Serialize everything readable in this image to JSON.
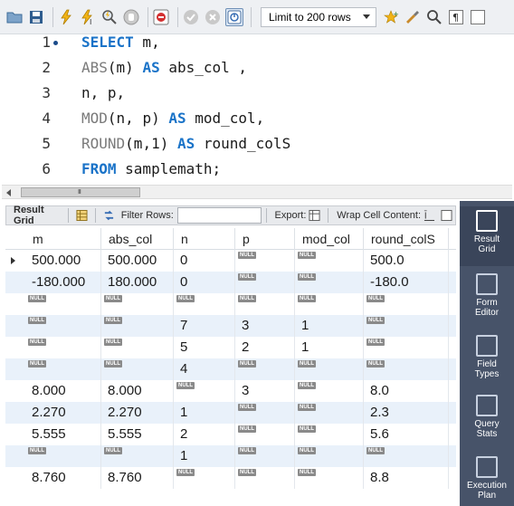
{
  "toolbar": {
    "limit_label": "Limit to 200 rows",
    "icons": [
      "folder-icon",
      "save-icon",
      "execute-icon",
      "execute-current-icon",
      "explain-icon",
      "stop-icon",
      "toggle-error-icon",
      "commit-icon",
      "rollback-icon",
      "autocommit-icon",
      "beautify-icon",
      "search-icon",
      "invisible-chars-icon",
      "wrap-icon"
    ]
  },
  "editor": {
    "line_numbers": [
      "1",
      "2",
      "3",
      "4",
      "5",
      "6"
    ],
    "lines": [
      [
        {
          "t": "SELECT",
          "c": "kw"
        },
        {
          "t": " m,",
          "c": ""
        }
      ],
      [
        {
          "t": "ABS",
          "c": "fn"
        },
        {
          "t": "(m) ",
          "c": ""
        },
        {
          "t": "AS",
          "c": "kw"
        },
        {
          "t": " abs_col ,",
          "c": ""
        }
      ],
      [
        {
          "t": "n, p,",
          "c": ""
        }
      ],
      [
        {
          "t": "MOD",
          "c": "fn"
        },
        {
          "t": "(n, p) ",
          "c": ""
        },
        {
          "t": "AS",
          "c": "kw"
        },
        {
          "t": " mod_col,",
          "c": ""
        }
      ],
      [
        {
          "t": "ROUND",
          "c": "fn"
        },
        {
          "t": "(m,1) ",
          "c": ""
        },
        {
          "t": "AS",
          "c": "kw"
        },
        {
          "t": " round_colS",
          "c": ""
        }
      ],
      [
        {
          "t": "FROM",
          "c": "kw"
        },
        {
          "t": " samplemath;",
          "c": ""
        }
      ]
    ]
  },
  "hscroll": {
    "grip": "III"
  },
  "result_toolbar": {
    "result_grid_label": "Result Grid",
    "filter_rows_label": "Filter Rows:",
    "filter_rows_value": "",
    "export_label": "Export:",
    "wrap_label": "Wrap Cell Content:"
  },
  "grid": {
    "null_text": "NULL",
    "columns": [
      "m",
      "abs_col",
      "n",
      "p",
      "mod_col",
      "round_colS"
    ],
    "rows": [
      [
        "500.000",
        "500.000",
        "0",
        null,
        null,
        "500.0"
      ],
      [
        "-180.000",
        "180.000",
        "0",
        null,
        null,
        "-180.0"
      ],
      [
        null,
        null,
        null,
        null,
        null,
        null
      ],
      [
        null,
        null,
        "7",
        "3",
        "1",
        null
      ],
      [
        null,
        null,
        "5",
        "2",
        "1",
        null
      ],
      [
        null,
        null,
        "4",
        null,
        null,
        null
      ],
      [
        "8.000",
        "8.000",
        null,
        "3",
        null,
        "8.0"
      ],
      [
        "2.270",
        "2.270",
        "1",
        null,
        null,
        "2.3"
      ],
      [
        "5.555",
        "5.555",
        "2",
        null,
        null,
        "5.6"
      ],
      [
        null,
        null,
        "1",
        null,
        null,
        null
      ],
      [
        "8.760",
        "8.760",
        null,
        null,
        null,
        "8.8"
      ]
    ]
  },
  "side_panel": {
    "items": [
      {
        "label_1": "Result",
        "label_2": "Grid",
        "icon": "result-grid-icon"
      },
      {
        "label_1": "Form",
        "label_2": "Editor",
        "icon": "form-editor-icon"
      },
      {
        "label_1": "Field",
        "label_2": "Types",
        "icon": "field-types-icon"
      },
      {
        "label_1": "Query",
        "label_2": "Stats",
        "icon": "query-stats-icon"
      },
      {
        "label_1": "Execution",
        "label_2": "Plan",
        "icon": "execution-plan-icon"
      }
    ]
  }
}
